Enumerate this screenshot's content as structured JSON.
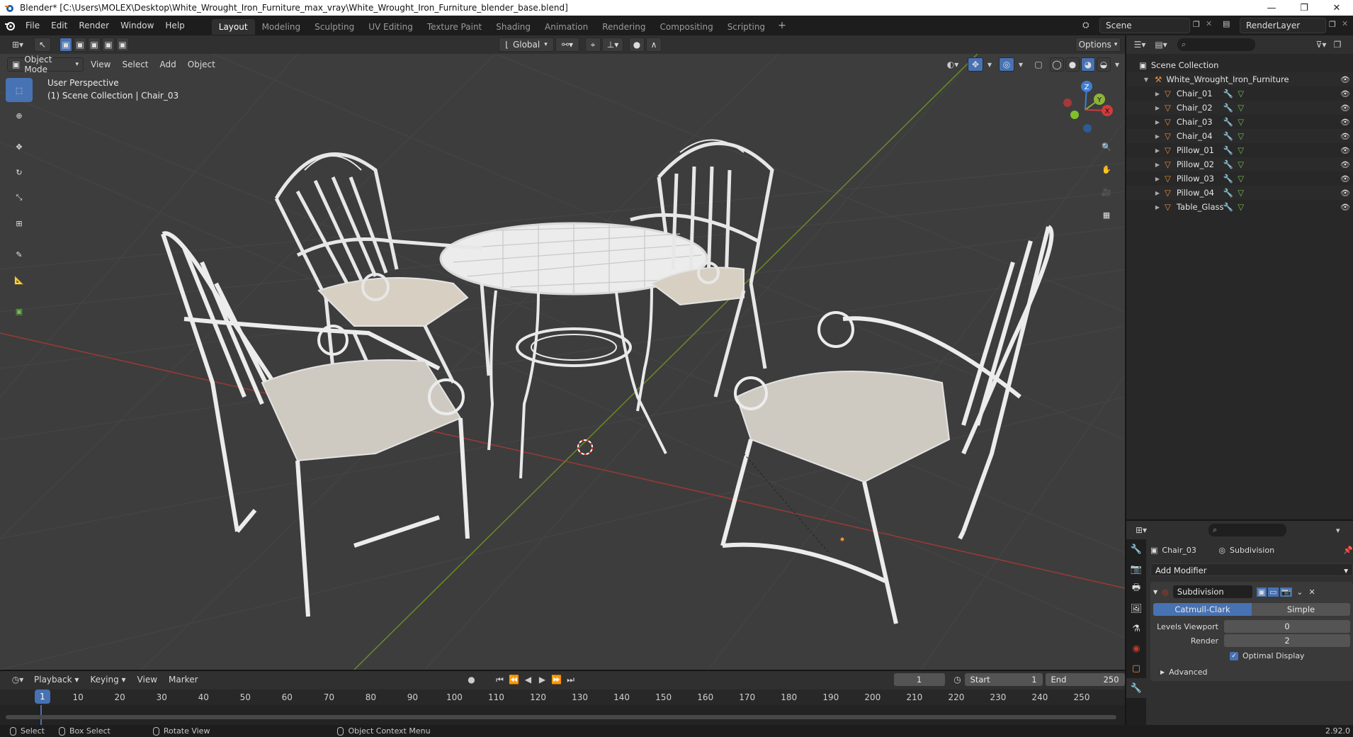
{
  "window": {
    "title": "Blender* [C:\\Users\\MOLEX\\Desktop\\White_Wrought_Iron_Furniture_max_vray\\White_Wrought_Iron_Furniture_blender_base.blend]",
    "minimize": "—",
    "maximize": "❐",
    "close": "✕"
  },
  "menu": [
    "File",
    "Edit",
    "Render",
    "Window",
    "Help"
  ],
  "workspaces": [
    "Layout",
    "Modeling",
    "Sculpting",
    "UV Editing",
    "Texture Paint",
    "Shading",
    "Animation",
    "Rendering",
    "Compositing",
    "Scripting"
  ],
  "workspace_active": "Layout",
  "scene_name": "Scene",
  "render_layer": "RenderLayer",
  "viewport": {
    "transform_orientation": "Global",
    "options_label": "Options",
    "mode": "Object Mode",
    "menus": [
      "View",
      "Select",
      "Add",
      "Object"
    ],
    "info_line1": "User Perspective",
    "info_line2": "(1) Scene Collection | Chair_03"
  },
  "gizmo": {
    "z": "Z",
    "y": "Y",
    "x": "X"
  },
  "outliner": {
    "root": "Scene Collection",
    "collection": "White_Wrought_Iron_Furniture",
    "objects": [
      "Chair_01",
      "Chair_02",
      "Chair_03",
      "Chair_04",
      "Pillow_01",
      "Pillow_02",
      "Pillow_03",
      "Pillow_04",
      "Table_Glass"
    ],
    "selected": "Chair_03"
  },
  "properties": {
    "object_name": "Chair_03",
    "modifier_context": "Subdivision",
    "add_modifier": "Add Modifier",
    "modifier_name": "Subdivision",
    "type_catmull": "Catmull-Clark",
    "type_simple": "Simple",
    "levels_viewport_label": "Levels Viewport",
    "levels_viewport_value": "0",
    "render_label": "Render",
    "render_value": "2",
    "optimal_display": "Optimal Display",
    "advanced": "Advanced"
  },
  "timeline": {
    "menus": [
      "Playback",
      "Keying",
      "View",
      "Marker"
    ],
    "current_frame": "1",
    "start_label": "Start",
    "start_value": "1",
    "end_label": "End",
    "end_value": "250",
    "ticks": [
      "10",
      "20",
      "30",
      "40",
      "50",
      "60",
      "70",
      "80",
      "90",
      "100",
      "110",
      "120",
      "130",
      "140",
      "150",
      "160",
      "170",
      "180",
      "190",
      "200",
      "210",
      "220",
      "230",
      "240",
      "250"
    ]
  },
  "statusbar": {
    "select": "Select",
    "box_select": "Box Select",
    "rotate_view": "Rotate View",
    "context_menu": "Object Context Menu",
    "version": "2.92.0"
  },
  "colors": {
    "accent": "#4772b3",
    "background": "#3d3d3d",
    "x_axis": "#c0392b",
    "y_axis": "#7fb02a"
  }
}
